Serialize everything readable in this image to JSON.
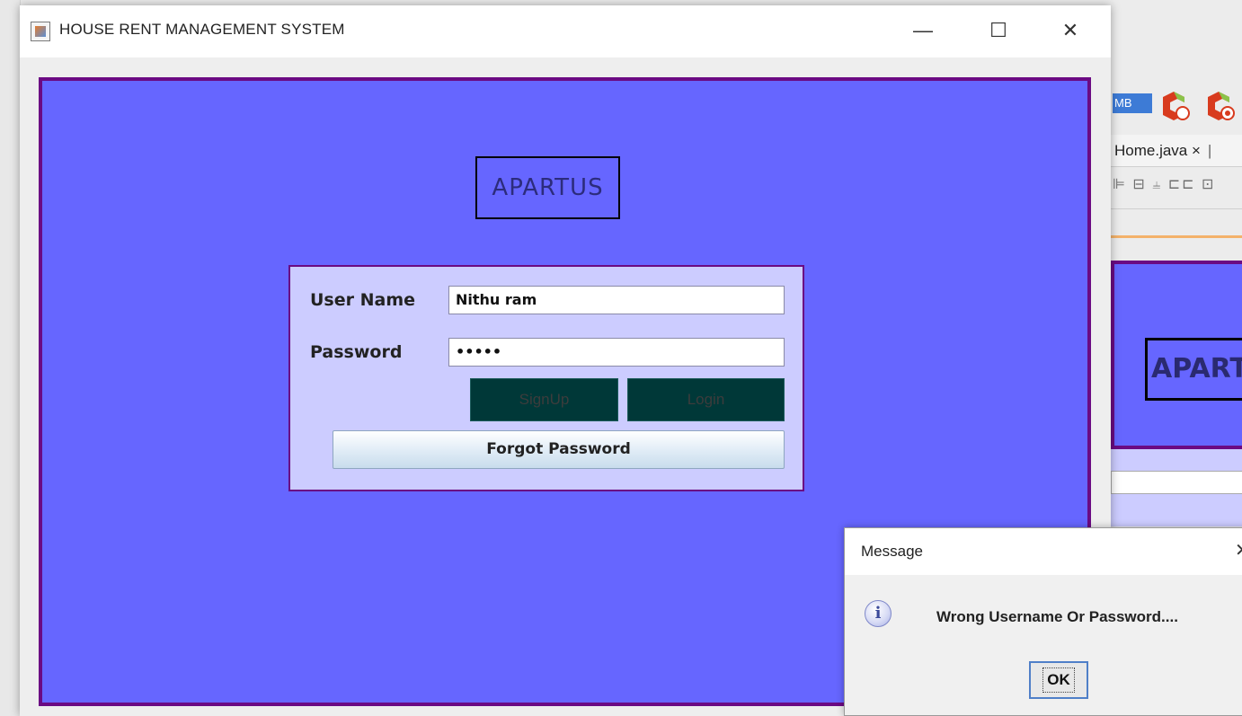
{
  "window": {
    "title": "HOUSE RENT MANAGEMENT SYSTEM",
    "controls": {
      "minimize": "—",
      "maximize": "☐",
      "close": "✕"
    }
  },
  "app": {
    "brand": "APARTUS",
    "form": {
      "username_label": "User Name",
      "username_value": "Nithu ram",
      "password_label": "Password",
      "password_value": "•••••",
      "signup_label": "SignUp",
      "login_label": "Login",
      "forgot_label": "Forgot Password"
    }
  },
  "dialog": {
    "title": "Message",
    "close": "✕",
    "icon": "i",
    "message": "Wrong Username Or Password....",
    "ok_label": "OK"
  },
  "background_ide": {
    "memory_badge": "MB",
    "tab_label": "Home.java ×",
    "tab_separator": "|",
    "tools_glyphs": "⊫ ⊟ ⫨ ⊏⊏ ⊡",
    "preview_brand": "APART"
  },
  "colors": {
    "panel": "#6666ff",
    "panel_border": "#6b0a83",
    "login_box": "#ccccff",
    "dark_button": "#003838"
  }
}
